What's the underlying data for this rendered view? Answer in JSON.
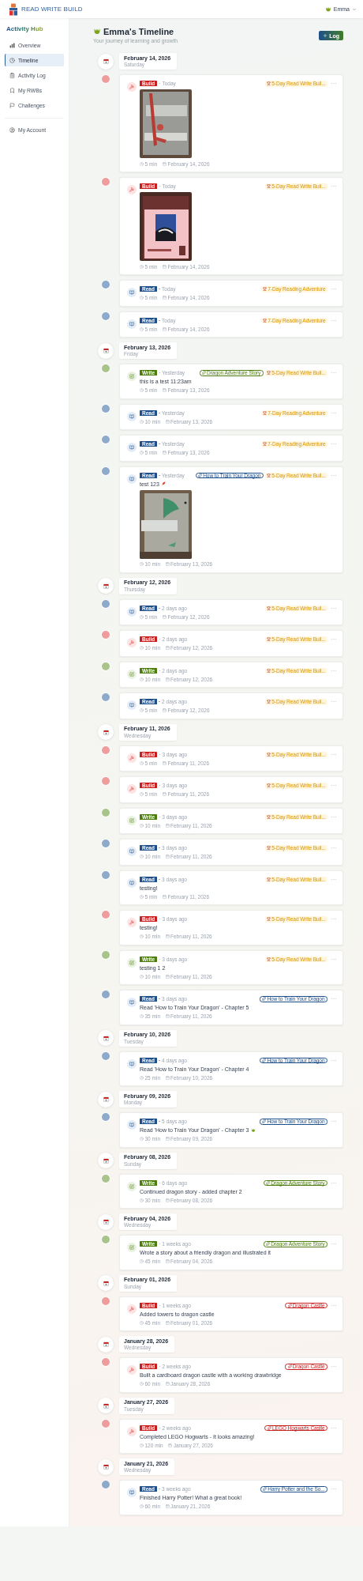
{
  "header": {
    "brand": "READ WRITE BUILD",
    "user": "Emma"
  },
  "sidebar": {
    "title": "Activity Hub",
    "items": [
      {
        "label": "Overview",
        "selected": false
      },
      {
        "label": "Timeline",
        "selected": true
      },
      {
        "label": "Activity Log",
        "selected": false
      },
      {
        "label": "My RWBs",
        "selected": false
      },
      {
        "label": "Challenges",
        "selected": false
      }
    ],
    "footer_items": [
      {
        "label": "My Account",
        "selected": false
      }
    ]
  },
  "page": {
    "title": "Emma's Timeline",
    "subtitle": "Your journey of learning and growth",
    "log_button": "Log"
  },
  "groups": [
    {
      "date": "February 14, 2026",
      "day": "Saturday",
      "entries": [
        {
          "kind": "build",
          "badge": "Build",
          "when": "Today",
          "photo": {
            "kind": "picture"
          },
          "tags": [
            {
              "kind": "challenge",
              "label": "5-Day Read Write Buil..."
            }
          ],
          "duration": "5 min",
          "date": "February 14, 2026"
        },
        {
          "kind": "build",
          "badge": "Build",
          "when": "Today",
          "photo": {
            "kind": "picture"
          },
          "tags": [
            {
              "kind": "challenge",
              "label": "5-Day Read Write Buil..."
            }
          ],
          "duration": "5 min",
          "date": "February 14, 2026"
        },
        {
          "kind": "read",
          "badge": "Read",
          "when": "Today",
          "tags": [
            {
              "kind": "challenge",
              "label": "7-Day Reading Adventure"
            }
          ],
          "duration": "5 min",
          "date": "February 14, 2026"
        },
        {
          "kind": "read",
          "badge": "Read",
          "when": "Today",
          "tags": [
            {
              "kind": "challenge",
              "label": "7-Day Reading Adventure"
            }
          ],
          "duration": "5 min",
          "date": "February 14, 2026"
        }
      ]
    },
    {
      "date": "February 13, 2026",
      "day": "Friday",
      "entries": [
        {
          "kind": "write",
          "badge": "Write",
          "when": "Yesterday",
          "text": "this is a test 11:23am",
          "tags": [
            {
              "kind": "project",
              "label": "Dragon Adventure Story",
              "color": "#4d7c0f"
            },
            {
              "kind": "challenge",
              "label": "5-Day Read Write Buil..."
            }
          ],
          "duration": "5 min",
          "date": "February 13, 2026"
        },
        {
          "kind": "read",
          "badge": "Read",
          "when": "Yesterday",
          "tags": [
            {
              "kind": "challenge",
              "label": "7-Day Reading Adventure"
            }
          ],
          "duration": "10 min",
          "date": "February 13, 2026"
        },
        {
          "kind": "read",
          "badge": "Read",
          "when": "Yesterday",
          "tags": [
            {
              "kind": "challenge",
              "label": "7-Day Reading Adventure"
            }
          ],
          "duration": "5 min",
          "date": "February 13, 2026"
        },
        {
          "kind": "read",
          "badge": "Read",
          "when": "Yesterday",
          "text": "test 123",
          "end_icon": {
            "kind": "rocket"
          },
          "photo": {
            "kind": "picture"
          },
          "tags": [
            {
              "kind": "project",
              "label": "How to Train Your Dragon",
              "color": "#1e4f8a"
            },
            {
              "kind": "challenge",
              "label": "5-Day Read Write Buil..."
            }
          ],
          "duration": "10 min",
          "date": "February 13, 2026"
        }
      ]
    },
    {
      "date": "February 12, 2026",
      "day": "Thursday",
      "entries": [
        {
          "kind": "read",
          "badge": "Read",
          "when": "2 days ago",
          "tags": [
            {
              "kind": "challenge",
              "label": "5-Day Read Write Buil..."
            }
          ],
          "duration": "5 min",
          "date": "February 12, 2026"
        },
        {
          "kind": "build",
          "badge": "Build",
          "when": "2 days ago",
          "tags": [
            {
              "kind": "challenge",
              "label": "5-Day Read Write Buil..."
            }
          ],
          "duration": "10 min",
          "date": "February 12, 2026"
        },
        {
          "kind": "write",
          "badge": "Write",
          "when": "2 days ago",
          "tags": [
            {
              "kind": "challenge",
              "label": "5-Day Read Write Buil..."
            }
          ],
          "duration": "10 min",
          "date": "February 12, 2026"
        },
        {
          "kind": "read",
          "badge": "Read",
          "when": "2 days ago",
          "tags": [
            {
              "kind": "challenge",
              "label": "5-Day Read Write Buil..."
            }
          ],
          "duration": "5 min",
          "date": "February 12, 2026"
        }
      ]
    },
    {
      "date": "February 11, 2026",
      "day": "Wednesday",
      "entries": [
        {
          "kind": "build",
          "badge": "Build",
          "when": "3 days ago",
          "tags": [
            {
              "kind": "challenge",
              "label": "5-Day Read Write Buil..."
            }
          ],
          "duration": "5 min",
          "date": "February 11, 2026"
        },
        {
          "kind": "build",
          "badge": "Build",
          "when": "3 days ago",
          "tags": [
            {
              "kind": "challenge",
              "label": "5-Day Read Write Buil..."
            }
          ],
          "duration": "5 min",
          "date": "February 11, 2026"
        },
        {
          "kind": "write",
          "badge": "Write",
          "when": "3 days ago",
          "tags": [
            {
              "kind": "challenge",
              "label": "5-Day Read Write Buil..."
            }
          ],
          "duration": "10 min",
          "date": "February 11, 2026"
        },
        {
          "kind": "read",
          "badge": "Read",
          "when": "3 days ago",
          "tags": [
            {
              "kind": "challenge",
              "label": "5-Day Read Write Buil..."
            }
          ],
          "duration": "10 min",
          "date": "February 11, 2026"
        },
        {
          "kind": "read",
          "badge": "Read",
          "when": "3 days ago",
          "text": "testing!",
          "tags": [
            {
              "kind": "challenge",
              "label": "5-Day Read Write Buil..."
            }
          ],
          "duration": "5 min",
          "date": "February 11, 2026"
        },
        {
          "kind": "build",
          "badge": "Build",
          "when": "3 days ago",
          "text": "testing!",
          "tags": [
            {
              "kind": "challenge",
              "label": "5-Day Read Write Buil..."
            }
          ],
          "duration": "10 min",
          "date": "February 11, 2026"
        },
        {
          "kind": "write",
          "badge": "Write",
          "when": "3 days ago",
          "text": "testing 1 2",
          "tags": [
            {
              "kind": "challenge",
              "label": "5-Day Read Write Buil..."
            }
          ],
          "duration": "10 min",
          "date": "February 11, 2026"
        },
        {
          "kind": "read",
          "badge": "Read",
          "when": "3 days ago",
          "text": "Read 'How to Train Your Dragon' - Chapter 5",
          "tags": [
            {
              "kind": "project",
              "label": "How to Train Your Dragon",
              "color": "#1e4f8a"
            }
          ],
          "duration": "35 min",
          "date": "February 11, 2026"
        }
      ]
    },
    {
      "date": "February 10, 2026",
      "day": "Tuesday",
      "entries": [
        {
          "kind": "read",
          "badge": "Read",
          "when": "4 days ago",
          "text": "Read 'How to Train Your Dragon' - Chapter 4",
          "tags": [
            {
              "kind": "project",
              "label": "How to Train Your Dragon",
              "color": "#1e4f8a"
            }
          ],
          "duration": "25 min",
          "date": "February 10, 2026"
        }
      ]
    },
    {
      "date": "February 09, 2026",
      "day": "Monday",
      "entries": [
        {
          "kind": "read",
          "badge": "Read",
          "when": "5 days ago",
          "text": "Read 'How to Train Your Dragon' - Chapter 3",
          "end_icon": {
            "kind": "dragon"
          },
          "tags": [
            {
              "kind": "project",
              "label": "How to Train Your Dragon",
              "color": "#1e4f8a"
            }
          ],
          "duration": "30 min",
          "date": "February 09, 2026"
        }
      ]
    },
    {
      "date": "February 08, 2026",
      "day": "Sunday",
      "entries": [
        {
          "kind": "write",
          "badge": "Write",
          "when": "6 days ago",
          "text": "Continued dragon story - added chapter 2",
          "tags": [
            {
              "kind": "project",
              "label": "Dragon Adventure Story",
              "color": "#4d7c0f"
            }
          ],
          "duration": "30 min",
          "date": "February 08, 2026"
        }
      ]
    },
    {
      "date": "February 04, 2026",
      "day": "Wednesday",
      "entries": [
        {
          "kind": "write",
          "badge": "Write",
          "when": "1 weeks ago",
          "text": "Wrote a story about a friendly dragon and illustrated it",
          "tags": [
            {
              "kind": "project",
              "label": "Dragon Adventure Story",
              "color": "#4d7c0f"
            }
          ],
          "duration": "45 min",
          "date": "February 04, 2026"
        }
      ]
    },
    {
      "date": "February 01, 2026",
      "day": "Sunday",
      "entries": [
        {
          "kind": "build",
          "badge": "Build",
          "when": "1 weeks ago",
          "text": "Added towers to dragon castle",
          "tags": [
            {
              "kind": "project",
              "label": "Dragon Castle",
              "color": "#c81e1e"
            }
          ],
          "duration": "45 min",
          "date": "February 01, 2026"
        }
      ]
    },
    {
      "date": "January 28, 2026",
      "day": "Wednesday",
      "entries": [
        {
          "kind": "build",
          "badge": "Build",
          "when": "2 weeks ago",
          "text": "Built a cardboard dragon castle with a working drawbridge",
          "tags": [
            {
              "kind": "project",
              "label": "Dragon Castle",
              "color": "#c81e1e"
            }
          ],
          "duration": "60 min",
          "date": "January 28, 2026"
        }
      ]
    },
    {
      "date": "January 27, 2026",
      "day": "Tuesday",
      "entries": [
        {
          "kind": "build",
          "badge": "Build",
          "when": "2 weeks ago",
          "text": "Completed LEGO Hogwarts - It looks amazing!",
          "tags": [
            {
              "kind": "project",
              "label": "LEGO Hogwarts Castle",
              "color": "#c81e1e"
            }
          ],
          "duration": "120 min",
          "date": "January 27, 2026"
        }
      ]
    },
    {
      "date": "January 21, 2026",
      "day": "Wednesday",
      "entries": [
        {
          "kind": "read",
          "badge": "Read",
          "when": "3 weeks ago",
          "text": "Finished Harry Potter! What a great book!",
          "tags": [
            {
              "kind": "project",
              "label": "Harry Potter and the So...",
              "color": "#1e4f8a"
            }
          ],
          "duration": "60 min",
          "date": "January 21, 2026"
        }
      ]
    }
  ]
}
